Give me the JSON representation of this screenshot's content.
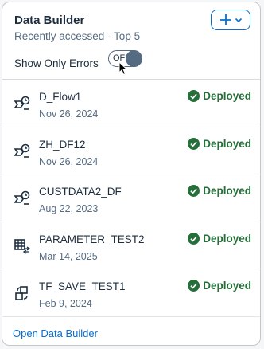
{
  "card": {
    "title": "Data Builder",
    "subtitle": "Recently accessed - Top 5",
    "toggle": {
      "label": "Show Only Errors",
      "state_text": "OFF"
    },
    "items": [
      {
        "name": "D_Flow1",
        "date": "Nov 26, 2024",
        "status": "Deployed",
        "icon": "data-flow-icon"
      },
      {
        "name": "ZH_DF12",
        "date": "Nov 26, 2024",
        "status": "Deployed",
        "icon": "data-flow-icon"
      },
      {
        "name": "CUSTDATA2_DF",
        "date": "Aug 22, 2023",
        "status": "Deployed",
        "icon": "data-flow-icon"
      },
      {
        "name": "PARAMETER_TEST2",
        "date": "Mar 14, 2025",
        "status": "Deployed",
        "icon": "table-icon"
      },
      {
        "name": "TF_SAVE_TEST1",
        "date": "Feb 9, 2024",
        "status": "Deployed",
        "icon": "transformation-flow-icon"
      }
    ],
    "footer_link": "Open Data Builder"
  },
  "colors": {
    "accent": "#0a6ed1",
    "success": "#256f3a",
    "text": "#1d2d3e",
    "muted": "#556b82"
  }
}
